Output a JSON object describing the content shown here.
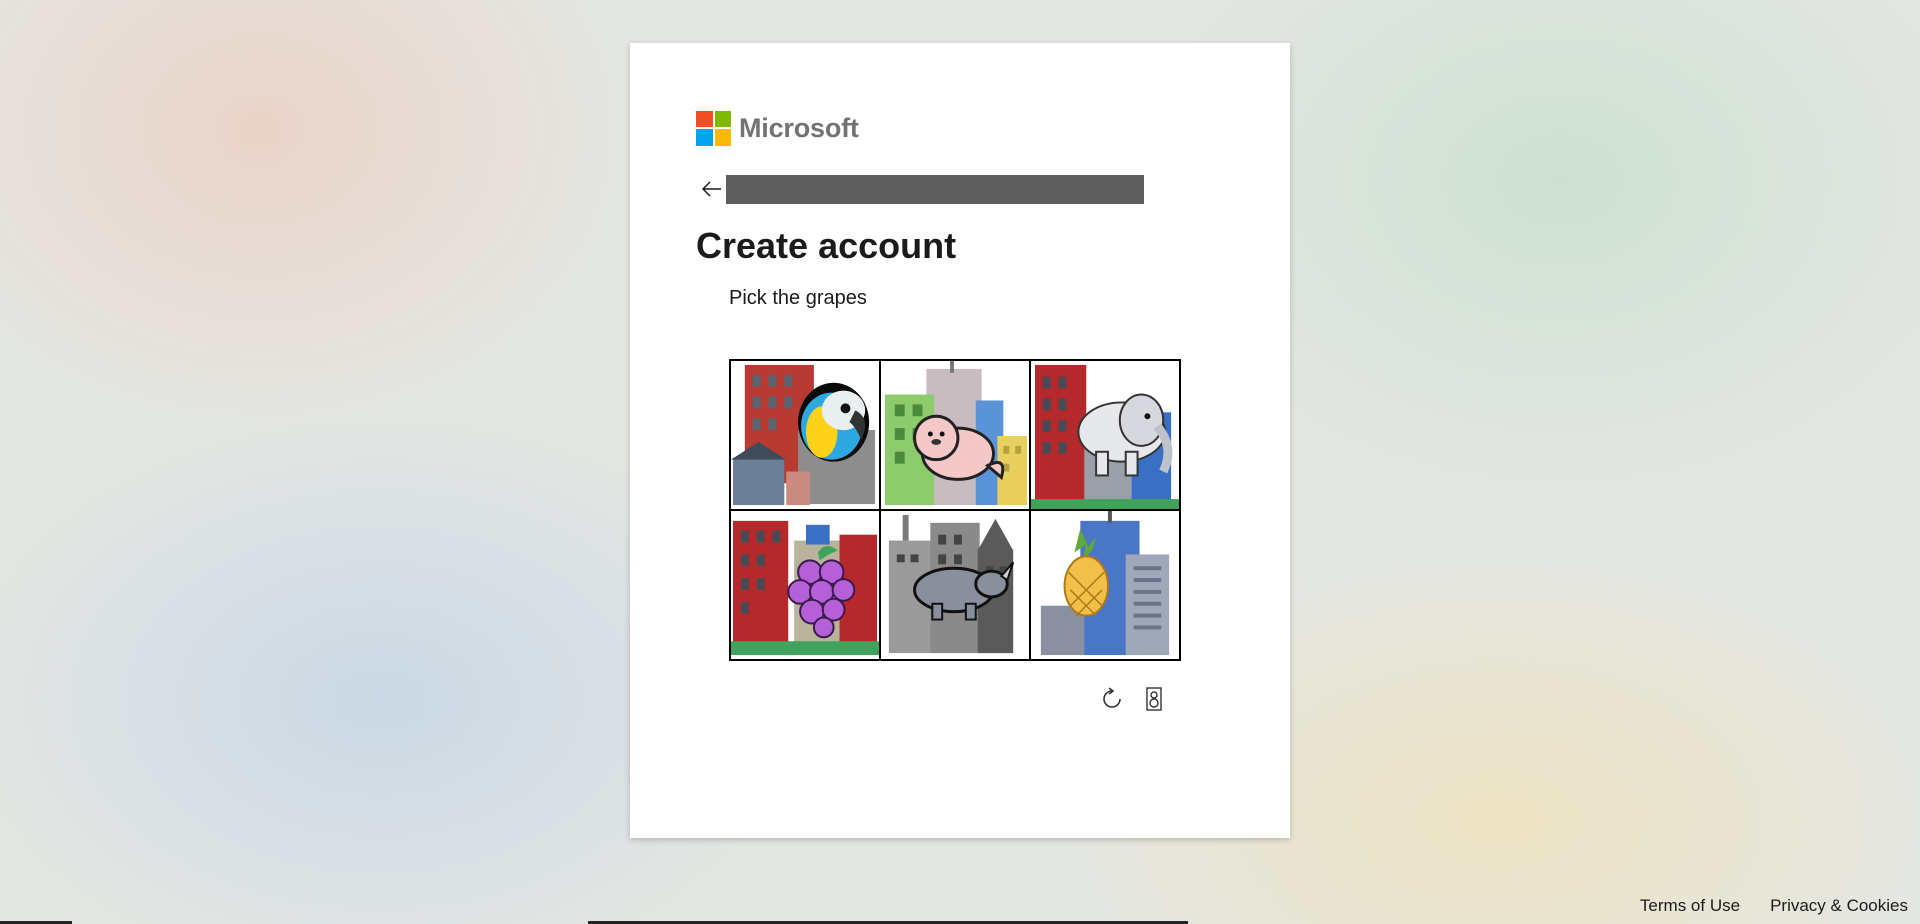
{
  "brand": {
    "name": "Microsoft",
    "colors": [
      "#f25022",
      "#7fba00",
      "#00a4ef",
      "#ffb900"
    ]
  },
  "page": {
    "title": "Create account",
    "back_icon": "arrow-left-icon"
  },
  "captcha": {
    "instruction": "Pick the grapes",
    "tiles": [
      {
        "icon": "parrot-icon"
      },
      {
        "icon": "seal-icon"
      },
      {
        "icon": "elephant-icon"
      },
      {
        "icon": "grapes-icon"
      },
      {
        "icon": "rhino-icon"
      },
      {
        "icon": "pineapple-icon"
      }
    ],
    "controls": [
      {
        "icon": "refresh-icon"
      },
      {
        "icon": "audio-icon"
      }
    ]
  },
  "footer": {
    "terms": "Terms of Use",
    "privacy": "Privacy & Cookies"
  }
}
